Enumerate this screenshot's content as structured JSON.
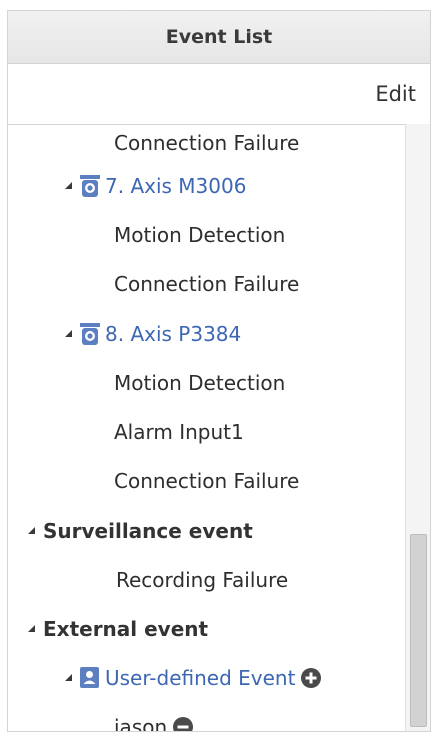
{
  "header": {
    "title": "Event List"
  },
  "toolbar": {
    "edit_label": "Edit"
  },
  "tree": {
    "partial_item": "Connection Failure",
    "cameras": [
      {
        "label": "7. Axis M3006",
        "events": [
          "Motion Detection",
          "Connection Failure"
        ]
      },
      {
        "label": "8. Axis P3384",
        "events": [
          "Motion Detection",
          "Alarm Input1",
          "Connection Failure"
        ]
      }
    ],
    "surveillance": {
      "label": "Surveillance event",
      "events": [
        "Recording Failure"
      ]
    },
    "external": {
      "label": "External event",
      "user_defined": {
        "label": "User-defined Event",
        "events": [
          "jason"
        ]
      }
    }
  },
  "icons": {
    "camera": "camera-icon",
    "user": "user-icon",
    "add": "plus-circle-icon",
    "remove": "minus-circle-icon",
    "expand": "expand-triangle-icon"
  },
  "colors": {
    "link": "#3d67b3",
    "icon_blue": "#5b7fc0",
    "header_bg": "#e9e9e9"
  }
}
